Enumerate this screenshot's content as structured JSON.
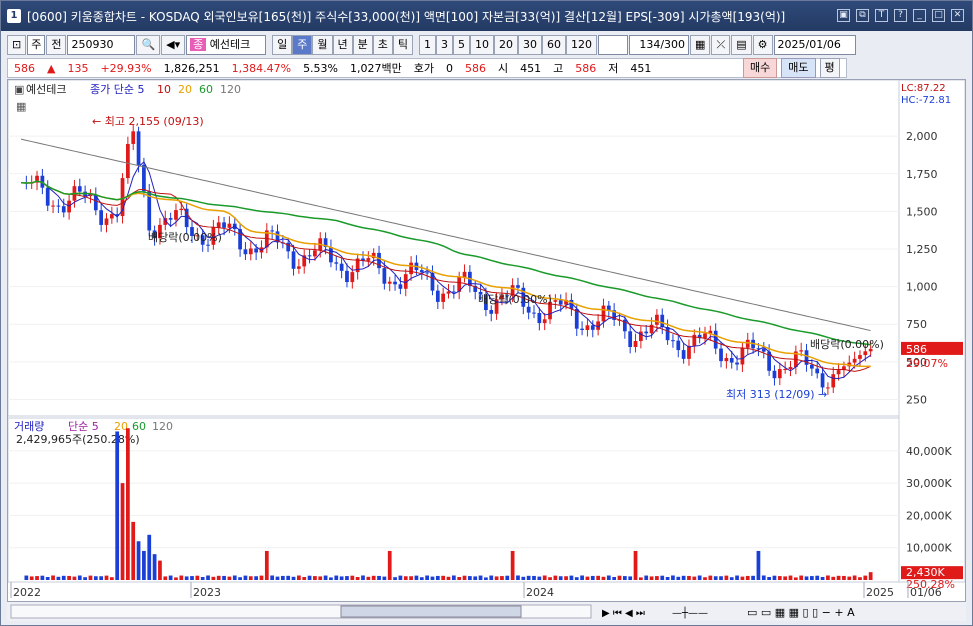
{
  "window": {
    "title": "[0600] 키움종합차트 - KOSDAQ 외국인보유[165(천)] 주식수[33,000(천)] 액면[100] 자본금[33(억)] 결산[12월] EPS[-309] 시가총액[193(억)]"
  },
  "toolbar": {
    "period_main": "주",
    "prefix": "전",
    "code": "250930",
    "stock_tag": "종",
    "stock_name": "예선테크",
    "period_buttons": [
      "일",
      "주",
      "월",
      "년",
      "분",
      "초",
      "틱"
    ],
    "active_period": "주",
    "interval_buttons": [
      "1",
      "3",
      "5",
      "10",
      "20",
      "30",
      "60",
      "120"
    ],
    "count": "134/300",
    "date": "2025/01/06"
  },
  "quote": {
    "price": "586",
    "change": "135",
    "change_pct": "+29.93%",
    "volume": "1,826,251",
    "volume_pct": "1,384.47%",
    "turnover": "5.53%",
    "amount": "1,027백만",
    "hoga_label": "호가",
    "hoga_val": "0",
    "bid": "586",
    "open_label": "시",
    "open": "451",
    "high_label": "고",
    "high": "586",
    "low_label": "저",
    "low": "451",
    "buy": "매수",
    "sell": "매도",
    "eval": "평"
  },
  "chart_data": {
    "type": "candlestick",
    "title": "예선테크",
    "legend": [
      "종가 단순 5",
      "10",
      "20",
      "60",
      "120"
    ],
    "legend_colors": [
      "#2020c0",
      "#c01010",
      "#e8a000",
      "#1a9a2a",
      "#777777"
    ],
    "y_ticks": [
      250,
      500,
      750,
      1000,
      1250,
      1500,
      1750,
      2000
    ],
    "ylim": [
      180,
      2320
    ],
    "lc": "LC:87.22",
    "hc": "HC:-72.81",
    "current_price": "586",
    "current_pct": "29.07%",
    "annotations": {
      "high": "최고 2,155 (09/13)",
      "low": "최저 313 (12/09)",
      "div1": "배당락(0.00%)",
      "div2": "배당락(0.00%)",
      "div3": "배당락(0.00%)"
    },
    "x_labels": [
      "2022",
      "2023",
      "2024",
      "2025",
      "01/06"
    ],
    "volume_panel": {
      "legend": [
        "거래량",
        "단순 5",
        "20",
        "60",
        "120"
      ],
      "current": "2,429,965주(250.28%)",
      "y_ticks": [
        "40,000K",
        "30,000K",
        "20,000K",
        "10,000K"
      ],
      "ylim": [
        0,
        48000
      ],
      "current_label": "2,430K",
      "pct_label": "250.28%"
    }
  }
}
